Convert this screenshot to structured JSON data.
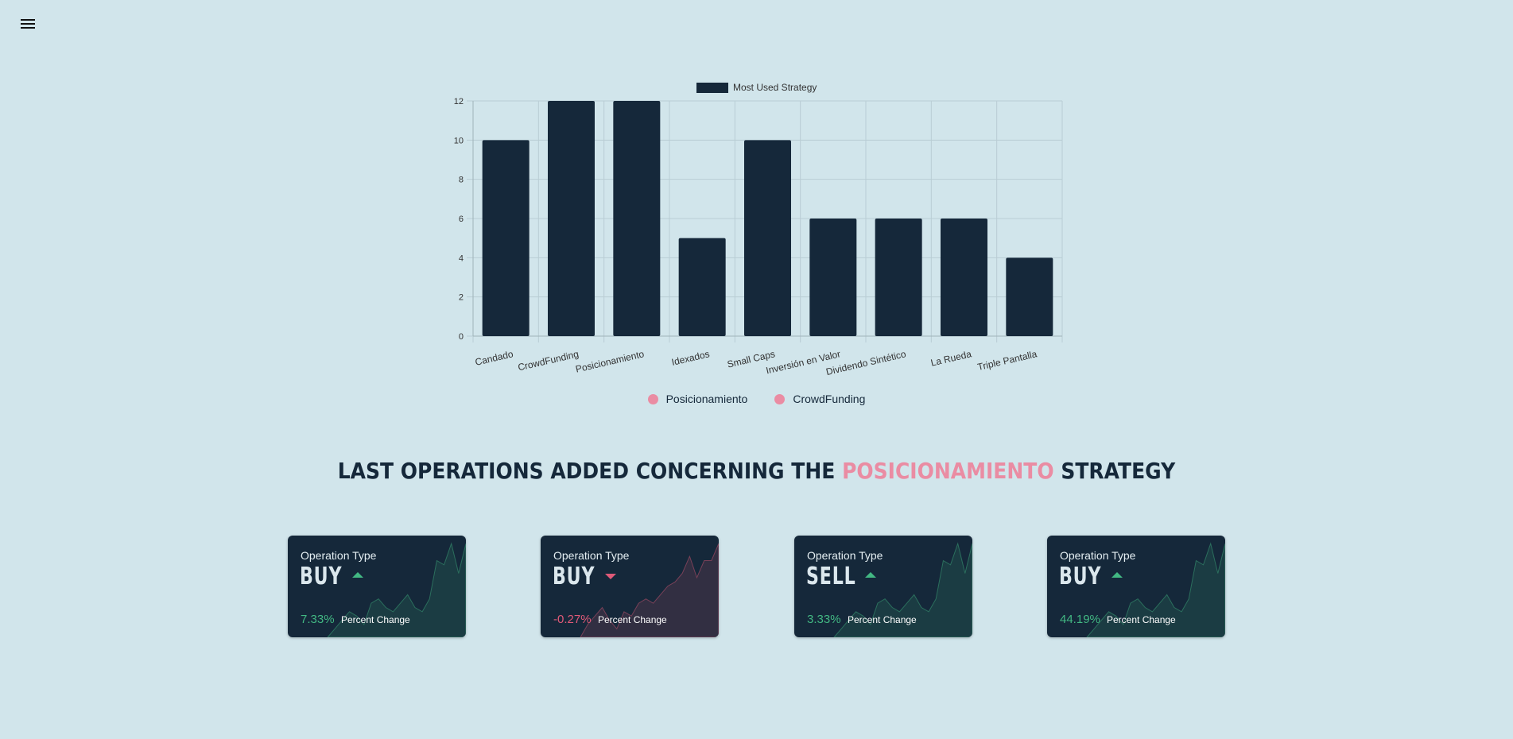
{
  "menu": {
    "icon": "hamburger-menu-icon"
  },
  "chart_data": {
    "type": "bar",
    "legend": "Most Used Strategy",
    "categories": [
      "Candado",
      "CrowdFunding",
      "Posicionamiento",
      "Idexados",
      "Small Caps",
      "Inversión en Valor",
      "Dividendo Sintético",
      "La Rueda",
      "Triple Pantalla"
    ],
    "values": [
      10,
      12,
      12,
      5,
      10,
      6,
      6,
      6,
      4
    ],
    "ylim": [
      0,
      12
    ],
    "yticks": [
      "0",
      "2",
      "4",
      "6",
      "8",
      "10",
      "12"
    ],
    "grid": true,
    "legend_position": "top-center",
    "bar_color": "#15283a"
  },
  "filters": [
    {
      "label": "Posicionamiento",
      "color": "#ea8ca3"
    },
    {
      "label": "CrowdFunding",
      "color": "#ea8ca3"
    }
  ],
  "heading": {
    "prefix": "Last operations added concerning the",
    "strategy": "Posicionamiento",
    "suffix": "strategy",
    "accent_color": "#ea8ca3"
  },
  "cards": [
    {
      "label": "Operation Type",
      "type": "BUY",
      "trend": "up",
      "percent": "7.33%",
      "percent_label": "Percent Change",
      "spark": [
        0,
        2,
        4,
        6,
        5,
        3,
        8,
        9,
        7,
        6,
        8,
        10,
        7,
        6,
        9,
        18,
        17,
        22,
        15,
        22
      ]
    },
    {
      "label": "Operation Type",
      "type": "BUY",
      "trend": "down",
      "percent": "-0.27%",
      "percent_label": "Percent Change",
      "spark": [
        0,
        3,
        5,
        7,
        4,
        2,
        6,
        5,
        8,
        9,
        8,
        10,
        12,
        13,
        15,
        19,
        14,
        18,
        18,
        22
      ]
    },
    {
      "label": "Operation Type",
      "type": "SELL",
      "trend": "up",
      "percent": "3.33%",
      "percent_label": "Percent Change",
      "spark": [
        0,
        2,
        4,
        6,
        5,
        3,
        8,
        9,
        7,
        6,
        8,
        10,
        7,
        6,
        9,
        18,
        17,
        22,
        15,
        22
      ]
    },
    {
      "label": "Operation Type",
      "type": "BUY",
      "trend": "up",
      "percent": "44.19%",
      "percent_label": "Percent Change",
      "spark": [
        0,
        2,
        4,
        6,
        5,
        3,
        8,
        9,
        7,
        6,
        8,
        10,
        7,
        6,
        9,
        18,
        17,
        22,
        15,
        22
      ]
    }
  ],
  "colors": {
    "background": "#d1e5eb",
    "card": "#15283a",
    "up": "#42b883",
    "down": "#e05a78"
  }
}
